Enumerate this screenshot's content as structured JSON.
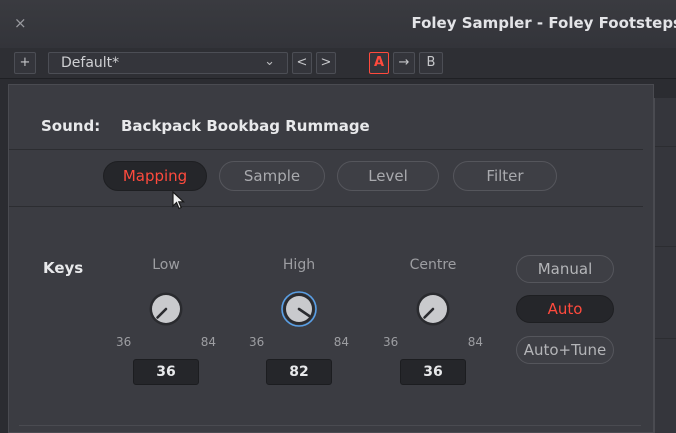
{
  "window": {
    "close_glyph": "×",
    "title": "Foley Sampler - Foley Footsteps"
  },
  "preset_bar": {
    "add_label": "+",
    "preset_name": "Default*",
    "dropdown_icon": "chevron-down-icon",
    "prev_label": "<",
    "next_label": ">",
    "ab_a": "A",
    "ab_copy": "→",
    "ab_b": "B"
  },
  "sound": {
    "label": "Sound:",
    "name": "Backpack Bookbag Rummage"
  },
  "tabs": [
    {
      "label": "Mapping",
      "active": true
    },
    {
      "label": "Sample",
      "active": false
    },
    {
      "label": "Level",
      "active": false
    },
    {
      "label": "Filter",
      "active": false
    }
  ],
  "keys": {
    "label": "Keys",
    "knobs": [
      {
        "title": "Low",
        "min": "36",
        "max": "84",
        "value": "36",
        "fraction": 0.0
      },
      {
        "title": "High",
        "min": "36",
        "max": "84",
        "value": "82",
        "fraction": 0.96
      },
      {
        "title": "Centre",
        "min": "36",
        "max": "84",
        "value": "36",
        "fraction": 0.0
      }
    ]
  },
  "mode_buttons": [
    {
      "label": "Manual",
      "active": false
    },
    {
      "label": "Auto",
      "active": true
    },
    {
      "label": "Auto+Tune",
      "active": false
    }
  ],
  "colors": {
    "accent_red": "#ff4a3d",
    "knob_ring_focus": "#5aa0e6"
  }
}
